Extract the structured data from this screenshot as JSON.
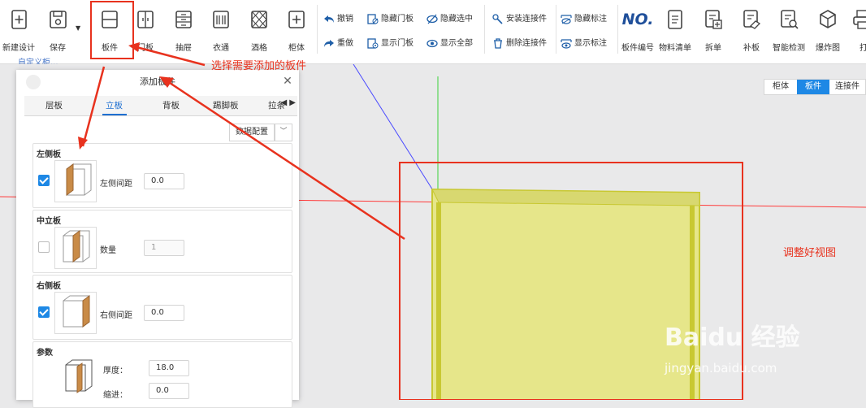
{
  "toolbar": {
    "big_left": [
      {
        "label": "新建设计",
        "icon": "new-design-icon"
      },
      {
        "label": "保存",
        "icon": "save-icon"
      },
      {
        "label": "板件",
        "icon": "panel-icon"
      },
      {
        "label": "门板",
        "icon": "door-panel-icon"
      },
      {
        "label": "抽屉",
        "icon": "drawer-icon"
      },
      {
        "label": "衣通",
        "icon": "clothes-rail-icon"
      },
      {
        "label": "酒格",
        "icon": "wine-rack-icon"
      },
      {
        "label": "柜体",
        "icon": "cabinet-icon"
      }
    ],
    "small_col1": [
      {
        "label": "撤销",
        "icon": "undo-icon"
      },
      {
        "label": "重做",
        "icon": "redo-icon"
      }
    ],
    "small_col2": [
      {
        "label": "隐藏门板",
        "icon": "hide-door-icon"
      },
      {
        "label": "显示门板",
        "icon": "show-door-icon"
      }
    ],
    "small_col3": [
      {
        "label": "隐藏选中",
        "icon": "hide-selected-icon"
      },
      {
        "label": "显示全部",
        "icon": "show-all-icon"
      }
    ],
    "small_col4": [
      {
        "label": "安装连接件",
        "icon": "install-connector-icon"
      },
      {
        "label": "删除连接件",
        "icon": "delete-connector-icon"
      }
    ],
    "small_col5": [
      {
        "label": "隐藏标注",
        "icon": "hide-annotation-icon"
      },
      {
        "label": "显示标注",
        "icon": "show-annotation-icon"
      }
    ],
    "big_right": [
      {
        "label": "板件编号",
        "icon": "panel-number-icon",
        "glyph": "NO."
      },
      {
        "label": "物料清单",
        "icon": "bom-icon"
      },
      {
        "label": "拆单",
        "icon": "split-order-icon"
      },
      {
        "label": "补板",
        "icon": "patch-panel-icon"
      },
      {
        "label": "智能检测",
        "icon": "smart-detect-icon"
      },
      {
        "label": "爆炸图",
        "icon": "exploded-view-icon"
      },
      {
        "label": "打",
        "icon": "print-icon"
      }
    ],
    "sub_label": "自定义柜..."
  },
  "view_tabs": [
    {
      "label": "柜体",
      "active": false
    },
    {
      "label": "板件",
      "active": true
    },
    {
      "label": "连接件",
      "active": false
    }
  ],
  "dialog": {
    "title": "添加板件",
    "tabs": [
      {
        "label": "层板",
        "active": false
      },
      {
        "label": "立板",
        "active": true
      },
      {
        "label": "背板",
        "active": false
      },
      {
        "label": "踢脚板",
        "active": false
      },
      {
        "label": "拉条",
        "active": false
      }
    ],
    "preset_button": "数据配置",
    "groups": {
      "left": {
        "title": "左侧板",
        "checked": true,
        "field_label": "左侧间距",
        "value": "0.0"
      },
      "middle": {
        "title": "中立板",
        "checked": false,
        "field_label": "数量",
        "value": "1"
      },
      "right": {
        "title": "右侧板",
        "checked": true,
        "field_label": "右侧间距",
        "value": "0.0"
      },
      "params": {
        "title": "参数",
        "thickness_label": "厚度：",
        "thickness": "18.0",
        "indent_label": "缩进：",
        "indent": "0.0"
      }
    }
  },
  "annotations": {
    "select_panel": "选择需要添加的板件",
    "adjust_view": "调整好视图"
  },
  "watermark": {
    "logo": "Baidu 经验",
    "url": "jingyan.baidu.com"
  },
  "colors": {
    "accent": "#1e88e5",
    "annotation": "#e8321e",
    "panel_fill": "#e6e68a",
    "panel_edge": "#c8c832"
  }
}
